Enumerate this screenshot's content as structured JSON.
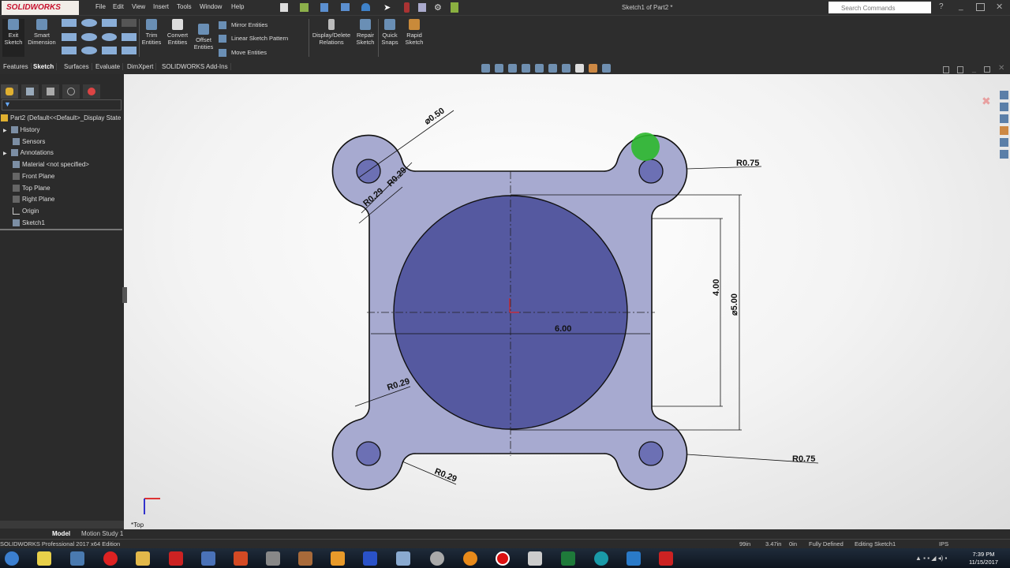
{
  "app": {
    "logo": "SOLIDWORKS",
    "title": "Sketch1 of Part2 *"
  },
  "menu": [
    "File",
    "Edit",
    "View",
    "Insert",
    "Tools",
    "Window",
    "Help"
  ],
  "search": {
    "placeholder": "Search Commands"
  },
  "ribbon": {
    "exit_sketch": "Exit Sketch",
    "smart_dimension": "Smart Dimension",
    "trim_entities": "Trim Entities",
    "convert_entities": "Convert Entities",
    "offset_entities": "Offset Entities",
    "mirror_entities": "Mirror Entities",
    "linear_sketch_pattern": "Linear Sketch Pattern",
    "move_entities": "Move Entities",
    "display_delete_relations": "Display/Delete Relations",
    "repair_sketch": "Repair Sketch",
    "quick_snaps": "Quick Snaps",
    "rapid_sketch": "Rapid Sketch"
  },
  "tabs": [
    "Features",
    "Sketch",
    "Surfaces",
    "Evaluate",
    "DimXpert",
    "SOLIDWORKS Add-Ins"
  ],
  "active_tab": "Sketch",
  "tree": {
    "root": "Part2  (Default<<Default>_Display State",
    "items": [
      "History",
      "Sensors",
      "Annotations",
      "Material <not specified>",
      "Front Plane",
      "Top Plane",
      "Right Plane",
      "Origin",
      "Sketch1"
    ]
  },
  "drawing": {
    "dims": {
      "hole_dia": "⌀0.50",
      "fillet": "R0.29",
      "boss_radius": "R0.75",
      "inner_height": "4.00",
      "circle_dia": "⌀5.00",
      "width": "6.00"
    },
    "view_label": "*Top",
    "colors": {
      "part_fill": "#a7aad0",
      "circle_fill": "#5559a0",
      "background": "#f3f3f3"
    }
  },
  "bottom_tabs": [
    "Model",
    "Motion Study 1"
  ],
  "status": {
    "edition": "SOLIDWORKS Professional 2017 x64 Edition",
    "x": "99in",
    "y": "3.47in",
    "z": "0in",
    "state": "Fully Defined",
    "mode": "Editing Sketch1",
    "units": "IPS"
  },
  "clock": {
    "time": "7:39 PM",
    "date": "11/15/2017"
  }
}
